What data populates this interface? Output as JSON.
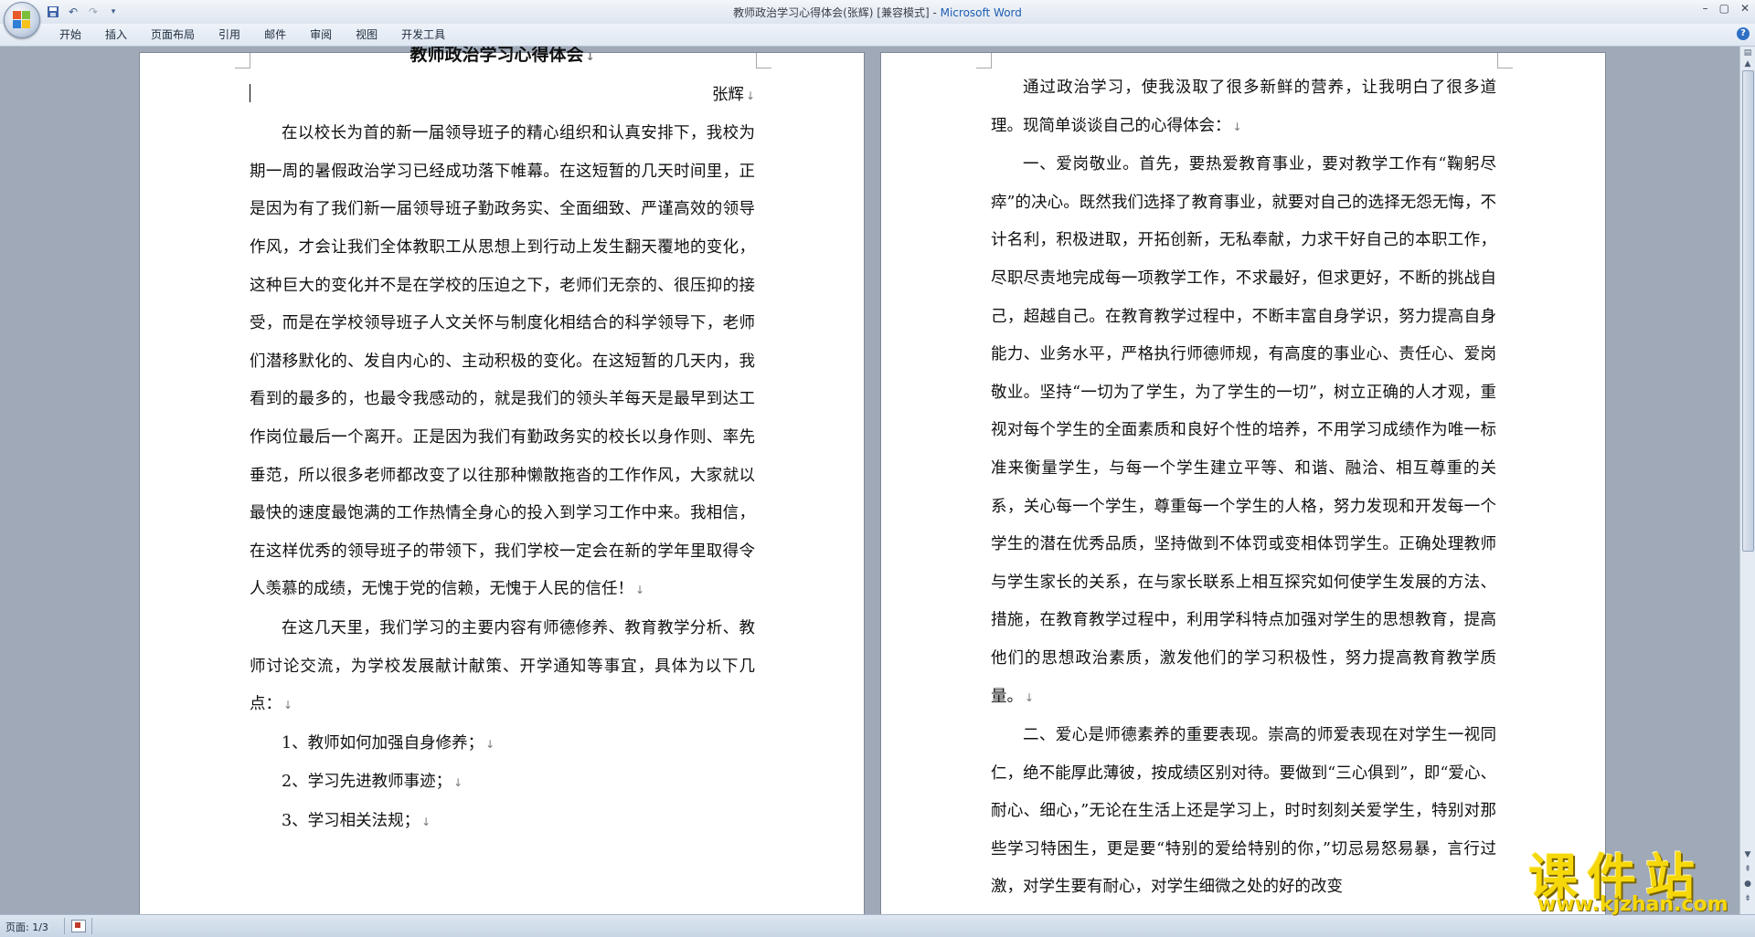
{
  "window": {
    "title": "教师政治学习心得体会(张辉) [兼容模式] - ",
    "app": "Microsoft Word",
    "controls": [
      "–",
      "▢",
      "✕"
    ]
  },
  "quick_access": {
    "icons": [
      "save-icon",
      "undo-icon",
      "redo-icon",
      "customize-icon"
    ]
  },
  "ribbon": {
    "tabs": [
      "开始",
      "插入",
      "页面布局",
      "引用",
      "邮件",
      "审阅",
      "视图",
      "开发工具"
    ]
  },
  "page1": {
    "title": "教师政治学习心得体会",
    "author": "张辉",
    "paragraphs": [
      "在以校长为首的新一届领导班子的精心组织和认真安排下，我校为期一周的暑假政治学习已经成功落下帷幕。在这短暂的几天时间里，正是因为有了我们新一届领导班子勤政务实、全面细致、严谨高效的领导作风，才会让我们全体教职工从思想上到行动上发生翻天覆地的变化，这种巨大的变化并不是在学校的压迫之下，老师们无奈的、很压抑的接受，而是在学校领导班子人文关怀与制度化相结合的科学领导下，老师们潜移默化的、发自内心的、主动积极的变化。在这短暂的几天内，我看到的最多的，也最令我感动的，就是我们的领头羊每天是最早到达工作岗位最后一个离开。正是因为我们有勤政务实的校长以身作则、率先垂范，所以很多老师都改变了以往那种懒散拖沓的工作作风，大家就以最快的速度最饱满的工作热情全身心的投入到学习工作中来。我相信，在这样优秀的领导班子的带领下，我们学校一定会在新的学年里取得令人羡慕的成绩，无愧于党的信赖，无愧于人民的信任！",
      "在这几天里，我们学习的主要内容有师德修养、教育教学分析、教师讨论交流，为学校发展献计献策、开学通知等事宜，具体为以下几点："
    ],
    "list": [
      "1、教师如何加强自身修养；",
      "2、学习先进教师事迹；",
      "3、学习相关法规；"
    ]
  },
  "page2": {
    "paragraphs": [
      "通过政治学习，使我汲取了很多新鲜的营养，让我明白了很多道理。现简单谈谈自己的心得体会：",
      "一、爱岗敬业。首先，要热爱教育事业，要对教学工作有“鞠躬尽瘁”的决心。既然我们选择了教育事业，就要对自己的选择无怨无悔，不计名利，积极进取，开拓创新，无私奉献，力求干好自己的本职工作，尽职尽责地完成每一项教学工作，不求最好，但求更好，不断的挑战自己，超越自己。在教育教学过程中，不断丰富自身学识，努力提高自身能力、业务水平，严格执行师德师规，有高度的事业心、责任心、爱岗敬业。坚持“一切为了学生，为了学生的一切”，树立正确的人才观，重视对每个学生的全面素质和良好个性的培养，不用学习成绩作为唯一标准来衡量学生，与每一个学生建立平等、和谐、融洽、相互尊重的关系，关心每一个学生，尊重每一个学生的人格，努力发现和开发每一个学生的潜在优秀品质，坚持做到不体罚或变相体罚学生。正确处理教师与学生家长的关系，在与家长联系上相互探究如何使学生发展的方法、措施，在教育教学过程中，利用学科特点加强对学生的思想教育，提高他们的思想政治素质，激发他们的学习积极性，努力提高教育教学质量。",
      "二、爱心是师德素养的重要表现。崇高的师爱表现在对学生一视同仁，绝不能厚此薄彼，按成绩区别对待。要做到“三心俱到”，即“爱心、耐心、细心，”无论在生活上还是学习上，时时刻刻关爱学生，特别对那些学习特困生，更是要“特别的爱给特别的你，”切忌易怒易暴，言行过激，对学生要有耐心，对学生细微之处的好的改变"
    ]
  },
  "paragraph_mark": "↓",
  "statusbar": {
    "page_count": "页面: 1/3"
  },
  "watermark": {
    "title": "课件站",
    "url": "www.kjzhan.com"
  },
  "colors": {
    "title_app": "#1e5db3",
    "workspace": "#9fa9b8",
    "watermark": "#f6d80a"
  }
}
